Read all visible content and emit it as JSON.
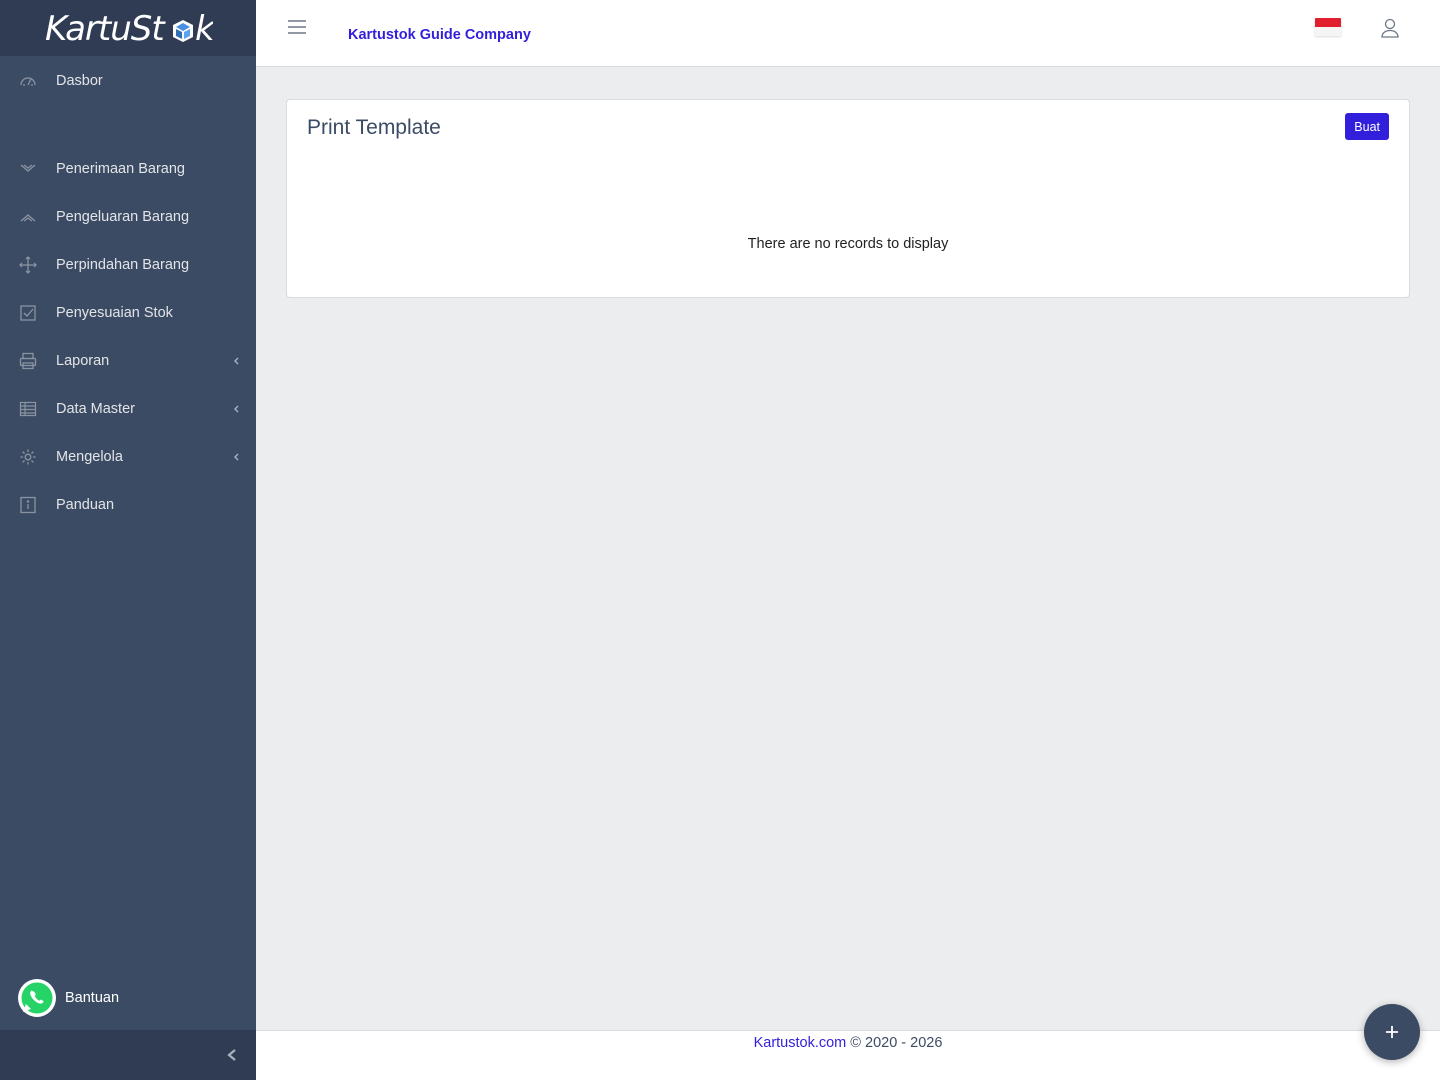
{
  "brand": {
    "name": "KartuStok"
  },
  "header": {
    "company_name": "Kartustok Guide Company",
    "language_flag": "indonesia-flag-icon",
    "user_icon": "user-icon"
  },
  "sidebar": {
    "items": [
      {
        "label": "Dasbor",
        "icon": "speedometer-icon",
        "has_caret": false
      },
      {
        "label": "Penerimaan Barang",
        "icon": "chevron-double-down-icon",
        "has_caret": false
      },
      {
        "label": "Pengeluaran Barang",
        "icon": "chevron-double-up-icon",
        "has_caret": false
      },
      {
        "label": "Perpindahan Barang",
        "icon": "move-icon",
        "has_caret": false
      },
      {
        "label": "Penyesuaian Stok",
        "icon": "task-icon",
        "has_caret": false
      },
      {
        "label": "Laporan",
        "icon": "print-icon",
        "has_caret": true
      },
      {
        "label": "Data Master",
        "icon": "spreadsheet-icon",
        "has_caret": true
      },
      {
        "label": "Mengelola",
        "icon": "settings-icon",
        "has_caret": true
      },
      {
        "label": "Panduan",
        "icon": "info-icon",
        "has_caret": false
      }
    ],
    "help_label": "Bantuan"
  },
  "card": {
    "title": "Print Template",
    "create_label": "Buat",
    "empty_message": "There are no records to display"
  },
  "footer": {
    "link_text": "Kartustok.com",
    "copyright": " © 2020 - 2026"
  },
  "colors": {
    "sidebar": "#3c4b64",
    "sidebar_dark": "#303c54",
    "primary": "#321fdb",
    "background": "#ebedef"
  }
}
